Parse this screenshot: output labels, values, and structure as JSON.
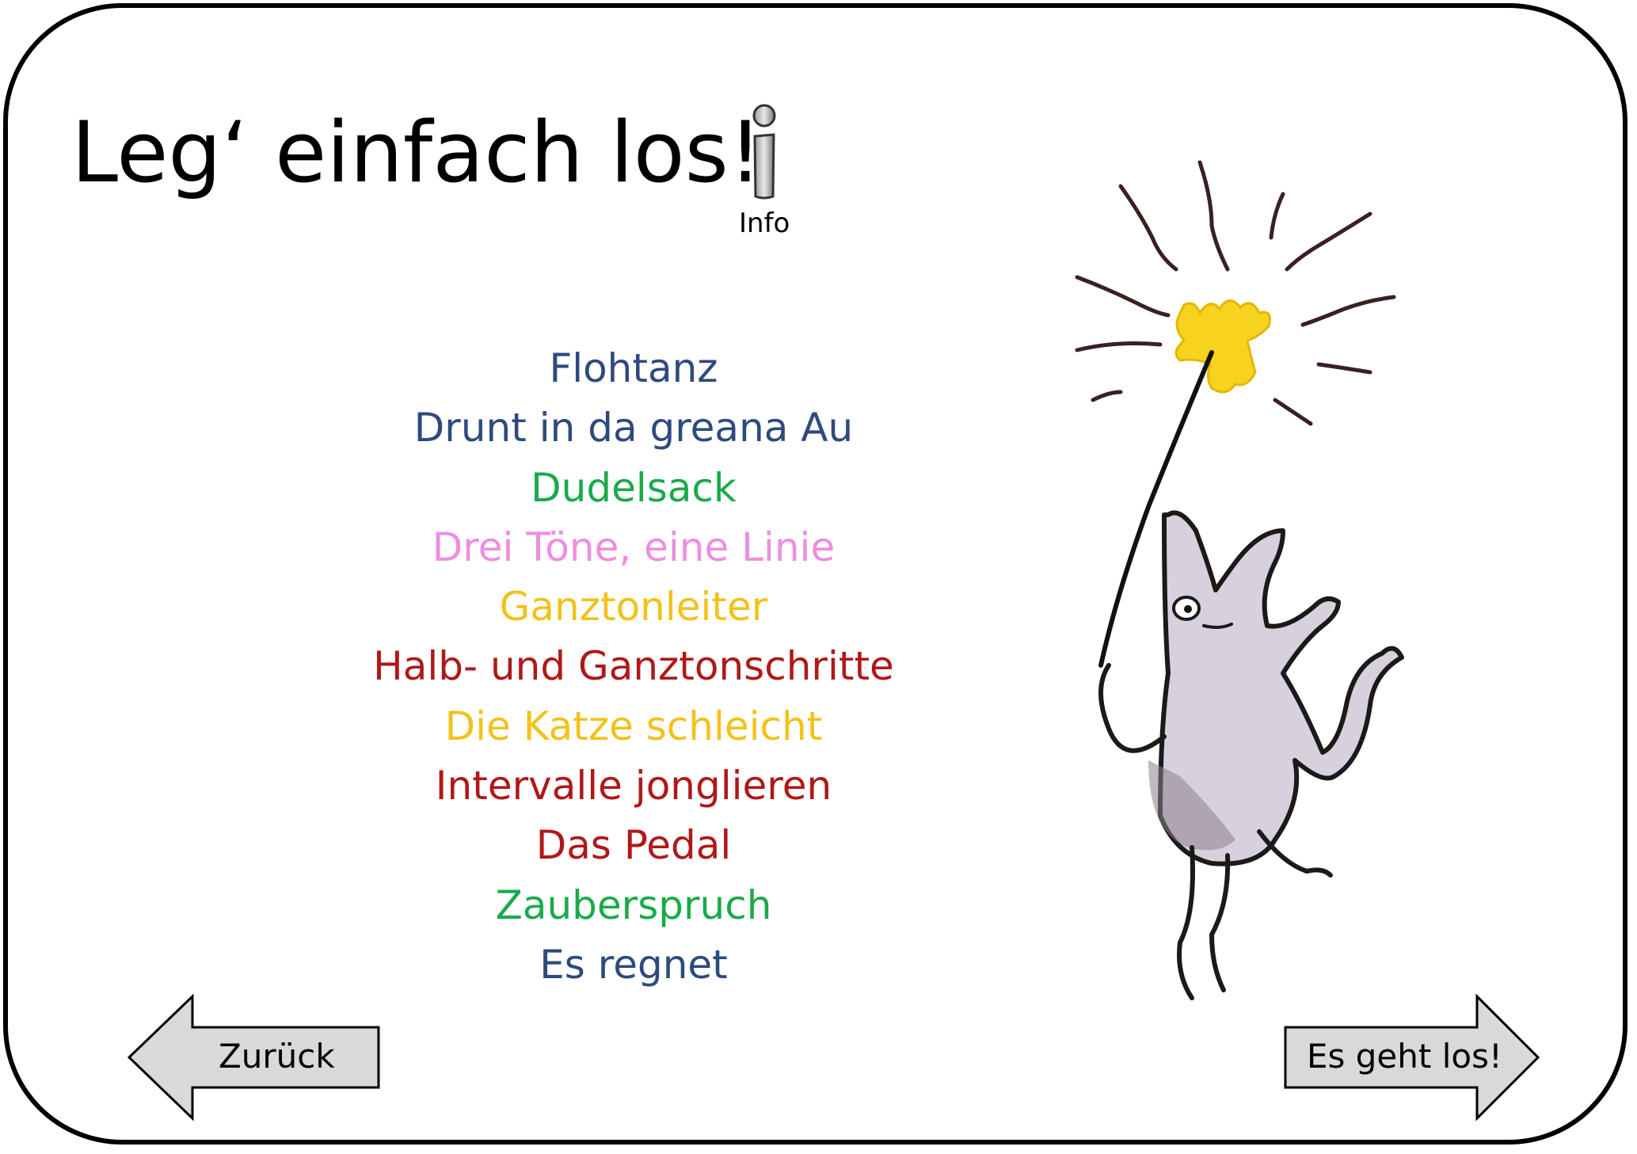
{
  "title": "Leg‘ einfach los!",
  "info": {
    "label": "Info",
    "icon": "info-icon"
  },
  "songs": [
    {
      "label": "Flohtanz",
      "color": "#2e4a7d"
    },
    {
      "label": "Drunt in da greana Au",
      "color": "#2e4a7d"
    },
    {
      "label": "Dudelsack",
      "color": "#1aaa4a"
    },
    {
      "label": "Drei Töne, eine Linie",
      "color": "#ee8ee0"
    },
    {
      "label": "Ganztonleiter",
      "color": "#f2c21a"
    },
    {
      "label": "Halb- und Ganztonschritte",
      "color": "#b01818"
    },
    {
      "label": "Die Katze schleicht",
      "color": "#f2c21a"
    },
    {
      "label": "Intervalle jonglieren",
      "color": "#b01818"
    },
    {
      "label": "Das Pedal",
      "color": "#b01818"
    },
    {
      "label": "Zauberspruch",
      "color": "#1aaa4a"
    },
    {
      "label": "Es regnet",
      "color": "#2e4a7d"
    }
  ],
  "nav": {
    "back_label": "Zurück",
    "next_label": "Es geht los!"
  },
  "colors": {
    "frame": "#000000",
    "button_fill": "#d9d9d9",
    "star": "#f7d21e",
    "dog": "#d8d0dc"
  }
}
